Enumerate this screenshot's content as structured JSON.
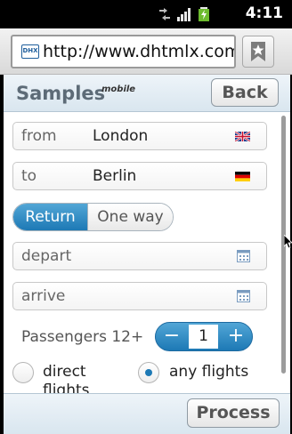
{
  "status_bar": {
    "time": "4:11",
    "icons": [
      "sync-icon",
      "signal-icon",
      "battery-charging-icon"
    ]
  },
  "browser": {
    "url": "http://www.dhtmlx.com/...",
    "favicon_text": "DHX",
    "bookmark_icon": "bookmark-star-icon"
  },
  "app": {
    "title": "Samples",
    "subtitle": "mobile",
    "back_label": "Back",
    "from": {
      "label": "from",
      "value": "London",
      "flag": "uk-flag-icon"
    },
    "to": {
      "label": "to",
      "value": "Berlin",
      "flag": "germany-flag-icon"
    },
    "trip_type": {
      "options": [
        "Return",
        "One way"
      ],
      "selected": "Return"
    },
    "depart": {
      "placeholder": "depart"
    },
    "arrive": {
      "placeholder": "arrive"
    },
    "passengers": {
      "label": "Passengers 12+",
      "value": "1",
      "minus": "−",
      "plus": "+"
    },
    "flights": {
      "options": [
        "direct flights",
        "any flights"
      ],
      "selected": "any flights"
    },
    "process_label": "Process"
  },
  "colors": {
    "accent": "#1d79b5",
    "header_bg": "#d9e6ef",
    "title_color": "#5d6b77"
  }
}
